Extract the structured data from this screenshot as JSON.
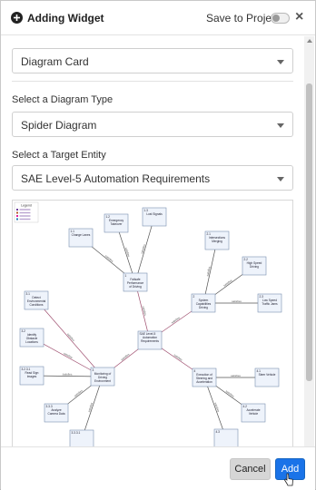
{
  "header": {
    "title": "Adding Widget",
    "save_to_project_label": "Save to Project",
    "close_label": "×"
  },
  "widget_select": {
    "value": "Diagram Card"
  },
  "diagram_type": {
    "label": "Select a Diagram Type",
    "value": "Spider Diagram"
  },
  "target_entity": {
    "label": "Select a Target Entity",
    "value": "SAE Level-5 Automation Requirements"
  },
  "diagram": {
    "legend": {
      "title": "Legend",
      "items": [
        "",
        "",
        "",
        ""
      ]
    },
    "nodes": [
      {
        "id": "center",
        "lines": [
          "SAE Level-5",
          "Automation",
          "Requirements"
        ]
      },
      {
        "id": "n1",
        "lines": [
          "1",
          "Failsafe",
          "Performance",
          "of Driving"
        ]
      },
      {
        "id": "n2",
        "lines": [
          "2",
          "System",
          "Capabilities",
          "Driving"
        ]
      },
      {
        "id": "n3",
        "lines": [
          "3",
          "Monitoring of",
          "Driving",
          "Environment"
        ]
      },
      {
        "id": "n4",
        "lines": [
          "4",
          "Execution of",
          "Steering and",
          "Acceleration"
        ]
      },
      {
        "id": "n11",
        "lines": [
          "1.1",
          "Change Lanes"
        ]
      },
      {
        "id": "n12",
        "lines": [
          "1.2",
          "Emergency",
          "Takeover"
        ]
      },
      {
        "id": "n13",
        "lines": [
          "1.3",
          "Lost Signals"
        ]
      },
      {
        "id": "n21",
        "lines": [
          "2.1",
          "Intersections",
          "Merging"
        ]
      },
      {
        "id": "n22",
        "lines": [
          "2.2",
          "High Speed",
          "Driving"
        ]
      },
      {
        "id": "n23",
        "lines": [
          "2.3",
          "Low Speed",
          "Traffic Jams"
        ]
      },
      {
        "id": "n31",
        "lines": [
          "3.1",
          "Detect",
          "Environmental",
          "Conditions"
        ]
      },
      {
        "id": "n32",
        "lines": [
          "3.2",
          "Identify",
          "Obstacle",
          "Locations"
        ]
      },
      {
        "id": "n33",
        "lines": [
          "3.2.3.1",
          "Read Sign",
          "Images"
        ]
      },
      {
        "id": "n34",
        "lines": [
          "3.3.3",
          "Analyze",
          "Camera Data"
        ]
      },
      {
        "id": "n35",
        "lines": [
          "3.3.3.1",
          ""
        ]
      },
      {
        "id": "n41",
        "lines": [
          "4.1",
          "Steer Vehicle"
        ]
      },
      {
        "id": "n42",
        "lines": [
          "4.2",
          "Accelerate",
          "Vehicle"
        ]
      },
      {
        "id": "n43",
        "lines": [
          "4.3",
          ""
        ]
      }
    ],
    "edge_label": "satisfies"
  },
  "footer": {
    "cancel_label": "Cancel",
    "add_label": "Add"
  },
  "colors": {
    "accent": "#1a73e8",
    "edge_main": "#a05070",
    "edge_sub": "#555555"
  }
}
